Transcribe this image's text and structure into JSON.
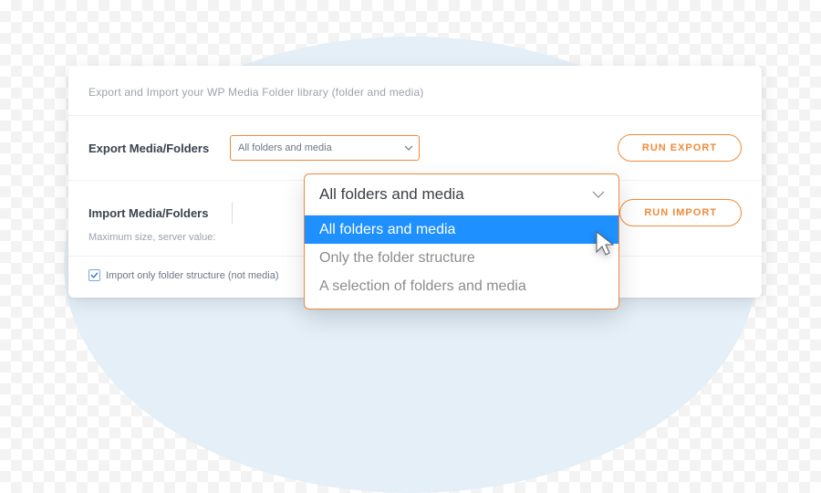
{
  "intro": "Export and Import your WP Media Folder library (folder and media)",
  "export": {
    "label": "Export Media/Folders",
    "select_value": "All folders and media",
    "button": "RUN EXPORT"
  },
  "import": {
    "label": "Import Media/Folders",
    "maxline": "Maximum size, server value:",
    "button": "RUN IMPORT"
  },
  "checkbox": {
    "label": "Import only folder structure (not media)"
  },
  "dropdown": {
    "selected": "All folders and media",
    "options": [
      "All folders and media",
      "Only the folder structure",
      "A selection of folders and media"
    ]
  }
}
